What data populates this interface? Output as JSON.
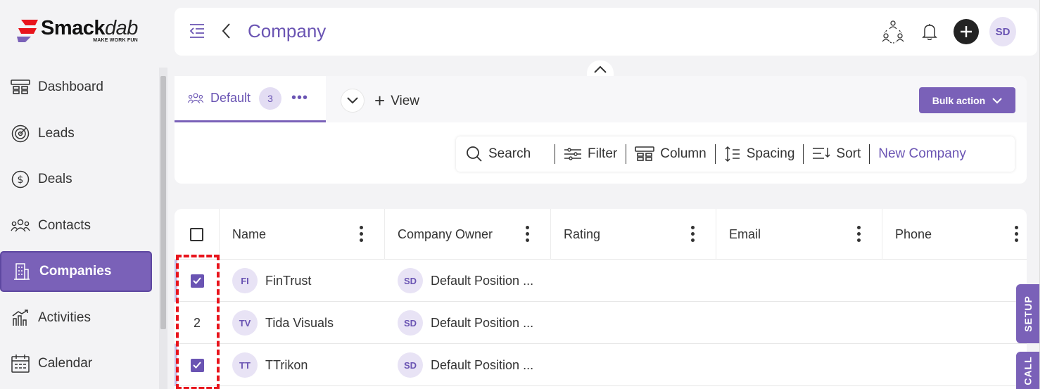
{
  "brand": {
    "name_bold": "Smack",
    "name_italic": "dab",
    "tagline": "MAKE WORK FUN",
    "accent": "#7a61b8"
  },
  "sidebar": {
    "items": [
      {
        "label": "Dashboard",
        "icon": "dashboard-icon"
      },
      {
        "label": "Leads",
        "icon": "target-icon"
      },
      {
        "label": "Deals",
        "icon": "dollar-icon"
      },
      {
        "label": "Contacts",
        "icon": "people-icon"
      },
      {
        "label": "Companies",
        "icon": "building-icon",
        "active": true
      },
      {
        "label": "Activities",
        "icon": "activities-icon"
      },
      {
        "label": "Calendar",
        "icon": "calendar-icon"
      }
    ]
  },
  "header": {
    "title": "Company",
    "avatar": "SD"
  },
  "tabs": {
    "default_label": "Default",
    "default_count": "3",
    "more": "•••",
    "add_view": "View"
  },
  "bulk_action": {
    "label": "Bulk action"
  },
  "toolbar": {
    "search": "Search",
    "filter": "Filter",
    "column": "Column",
    "spacing": "Spacing",
    "sort": "Sort",
    "new": "New Company"
  },
  "table": {
    "columns": [
      "Name",
      "Company Owner",
      "Rating",
      "Email",
      "Phone"
    ],
    "rows": [
      {
        "checked": true,
        "index": "",
        "initials": "FI",
        "name": "FinTrust",
        "owner_initials": "SD",
        "owner": "Default Position ..."
      },
      {
        "checked": false,
        "index": "2",
        "initials": "TV",
        "name": "Tida Visuals",
        "owner_initials": "SD",
        "owner": "Default Position ..."
      },
      {
        "checked": true,
        "index": "",
        "initials": "TT",
        "name": "TTrikon",
        "owner_initials": "SD",
        "owner": "Default Position ..."
      }
    ]
  },
  "side_tabs": {
    "setup": "SETUP",
    "call": "CALL"
  }
}
